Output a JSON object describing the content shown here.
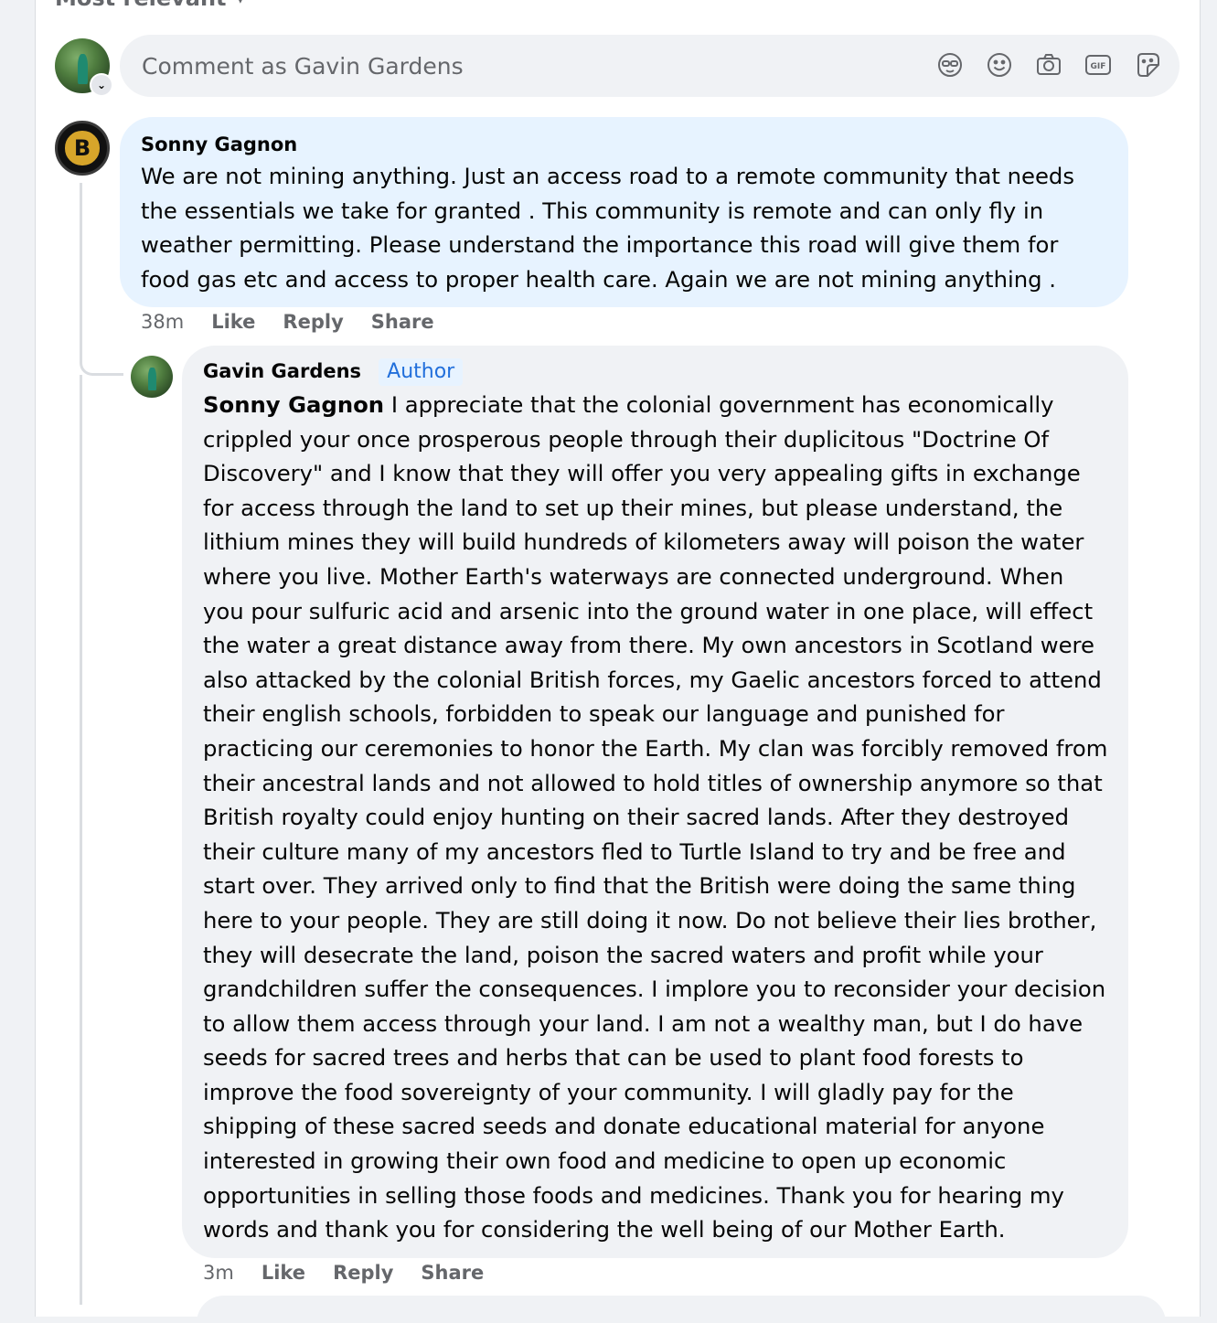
{
  "sort": {
    "label": "Most relevant"
  },
  "composer": {
    "placeholder": "Comment as Gavin Gardens",
    "tools": [
      "avatar-sticker-icon",
      "emoji-icon",
      "camera-icon",
      "gif-icon",
      "sticker-icon"
    ]
  },
  "comment": {
    "author": "Sonny Gagnon",
    "text": "We are not mining anything. Just an access road to a remote community that needs the essentials we take for granted . This community is remote and can only fly in weather permitting. Please understand the importance this road will give them for food gas etc and access to proper health care. Again we are not mining anything .",
    "time": "38m",
    "like": "Like",
    "reply": "Reply",
    "share": "Share"
  },
  "reply": {
    "author": "Gavin Gardens",
    "badge": "Author",
    "mention": "Sonny Gagnon",
    "text": " I appreciate that the colonial government has economically crippled your once prosperous people through their duplicitous \"Doctrine Of Discovery\" and I know that they will offer you very appealing gifts in exchange for access through the land to set up their mines, but please understand, the lithium mines they will build hundreds of kilometers away will poison the water where you live. Mother Earth's waterways are connected underground. When you pour sulfuric acid and arsenic into the ground water in one place, will effect the water a great distance away from there. My own ancestors in Scotland were also attacked by the colonial British forces, my Gaelic ancestors forced to attend their english schools, forbidden to speak our language and punished for practicing our ceremonies to honor the Earth. My clan was forcibly removed from their ancestral lands and not allowed to hold titles of ownership anymore so that British royalty could enjoy hunting on their sacred lands. After they destroyed their culture many of my ancestors fled to Turtle Island to try and be free and start over. They arrived only to find that the British were doing the same thing here to your people. They are still doing it now. Do not believe their lies brother, they will desecrate the land, poison the sacred waters and profit while your grandchildren suffer the consequences. I implore you to reconsider your decision to allow them access through your land. I am not a wealthy man, but I do have seeds for sacred trees and herbs that can be used to plant food forests to improve the food sovereignty of your community. I will gladly pay for the shipping of these sacred seeds and donate educational material for anyone interested in growing their own food and medicine to open up economic opportunities in selling those foods and medicines. Thank you for hearing my words and thank you for considering the well being of our Mother Earth.",
    "time": "3m",
    "like": "Like",
    "reply": "Reply",
    "share": "Share"
  },
  "colors": {
    "page_bg": "#f0f2f5",
    "comment_bubble": "#e7f3ff",
    "reply_bubble": "#f0f2f5",
    "author_badge_text": "#216fdb",
    "secondary_text": "#65676b"
  }
}
